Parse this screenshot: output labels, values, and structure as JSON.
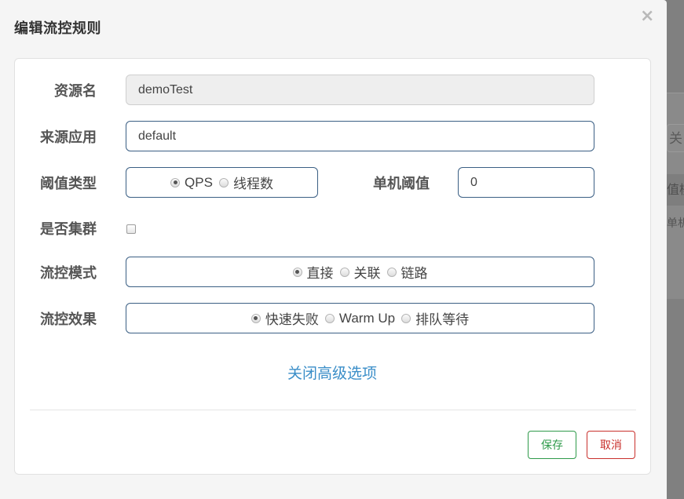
{
  "dialog": {
    "title": "编辑流控规则",
    "close": "×"
  },
  "form": {
    "resource": {
      "label": "资源名",
      "value": "demoTest"
    },
    "limit_app": {
      "label": "来源应用",
      "value": "default"
    },
    "grade": {
      "label": "阈值类型",
      "options": [
        "QPS",
        "线程数"
      ],
      "selected": "QPS"
    },
    "threshold": {
      "label": "单机阈值",
      "value": "0"
    },
    "cluster": {
      "label": "是否集群",
      "checked": false
    },
    "strategy": {
      "label": "流控模式",
      "options": [
        "直接",
        "关联",
        "链路"
      ],
      "selected": "直接"
    },
    "control_behavior": {
      "label": "流控效果",
      "options": [
        "快速失败",
        "Warm Up",
        "排队等待"
      ],
      "selected": "快速失败"
    },
    "advanced_toggle": "关闭高级选项"
  },
  "footer": {
    "save_label": "保存",
    "cancel_label": "取消"
  },
  "background": {
    "search_fragment": "关",
    "header_fragment": "值模",
    "cell_fragment": "单机"
  },
  "colors": {
    "primary_border": "#3b5f84",
    "link": "#3a8ec8",
    "save": "#2e9a4a",
    "cancel": "#c9302c"
  }
}
